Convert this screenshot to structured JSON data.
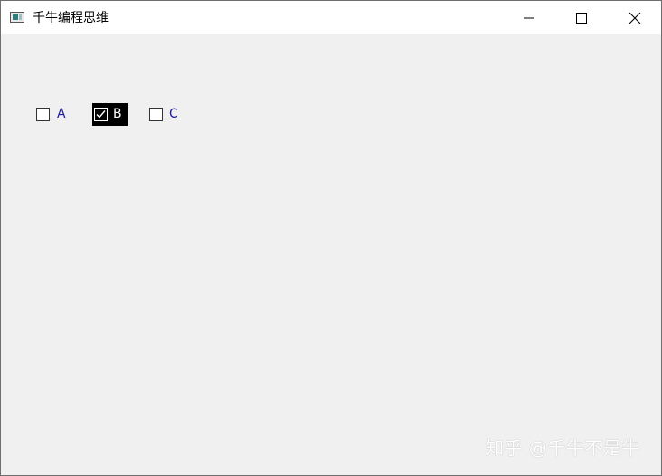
{
  "window": {
    "title": "千牛编程思维",
    "icon": "window-app-icon"
  },
  "caption_buttons": {
    "minimize_icon": "minimize-icon",
    "maximize_icon": "maximize-icon",
    "close_icon": "close-icon"
  },
  "checkboxes": [
    {
      "label": "A",
      "checked": false
    },
    {
      "label": "B",
      "checked": true
    },
    {
      "label": "C",
      "checked": false
    }
  ],
  "watermark": "知乎 @千牛不是牛",
  "colors": {
    "label_text": "#1a1aa6",
    "window_bg": "#f0f0f0",
    "selected_bg": "#000000"
  }
}
